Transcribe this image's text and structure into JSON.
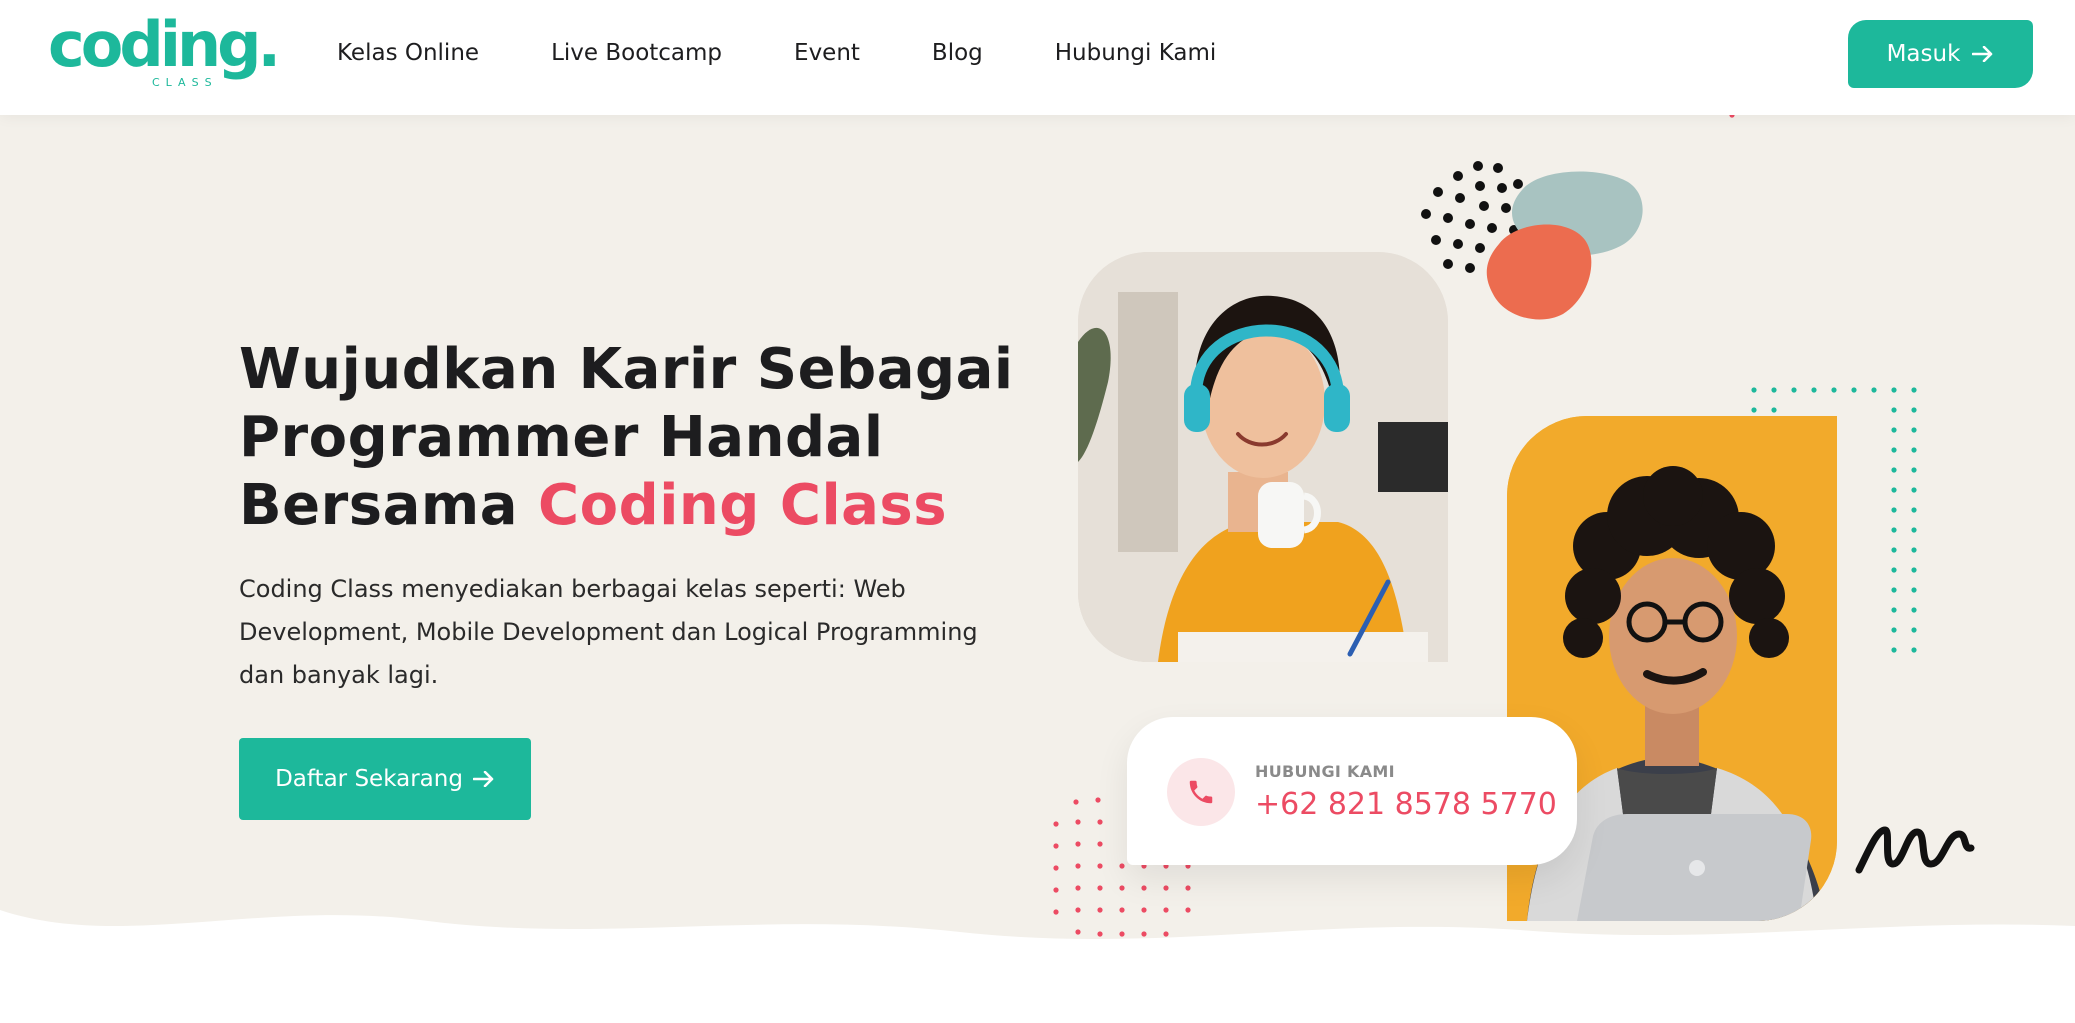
{
  "brand": {
    "logo_word": "coding.",
    "logo_sub": "CLASS",
    "accent_color": "#1db89b",
    "highlight_color": "#ec4b63"
  },
  "nav": {
    "items": [
      {
        "label": "Kelas Online"
      },
      {
        "label": "Live Bootcamp"
      },
      {
        "label": "Event"
      },
      {
        "label": "Blog"
      },
      {
        "label": "Hubungi Kami"
      }
    ],
    "login_label": "Masuk"
  },
  "hero": {
    "title_line1": "Wujudkan Karir Sebagai",
    "title_line2": "Programmer Handal",
    "title_line3_prefix": "Bersama",
    "title_highlight": "Coding Class",
    "description": "Coding Class menyediakan berbagai kelas seperti: Web Development, Mobile Development dan Logical Programming dan banyak lagi.",
    "cta_label": "Daftar Sekarang"
  },
  "contact": {
    "label": "HUBUNGI KAMI",
    "phone": "+62 821 8578 5770",
    "icon": "phone-icon"
  },
  "images": {
    "photo1": "woman-with-headphones-photo",
    "photo2": "man-with-laptop-photo"
  }
}
